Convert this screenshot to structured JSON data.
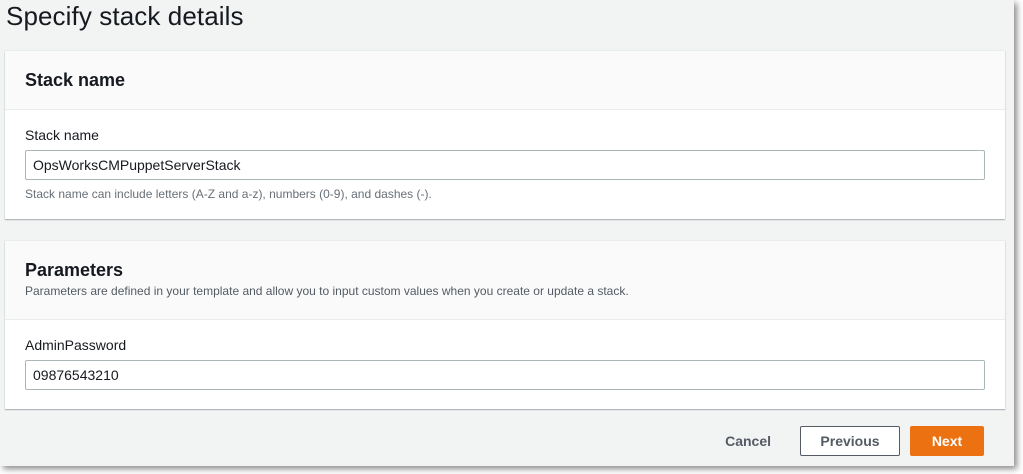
{
  "page": {
    "title": "Specify stack details"
  },
  "stack_name_panel": {
    "title": "Stack name",
    "field_label": "Stack name",
    "field_value": "OpsWorksCMPuppetServerStack",
    "hint": "Stack name can include letters (A-Z and a-z), numbers (0-9), and dashes (-)."
  },
  "parameters_panel": {
    "title": "Parameters",
    "description": "Parameters are defined in your template and allow you to input custom values when you create or update a stack.",
    "field_label": "AdminPassword",
    "field_value": "09876543210"
  },
  "footer": {
    "cancel_label": "Cancel",
    "previous_label": "Previous",
    "next_label": "Next"
  },
  "colors": {
    "primary_button": "#ec7211",
    "background": "#f2f3f3"
  }
}
